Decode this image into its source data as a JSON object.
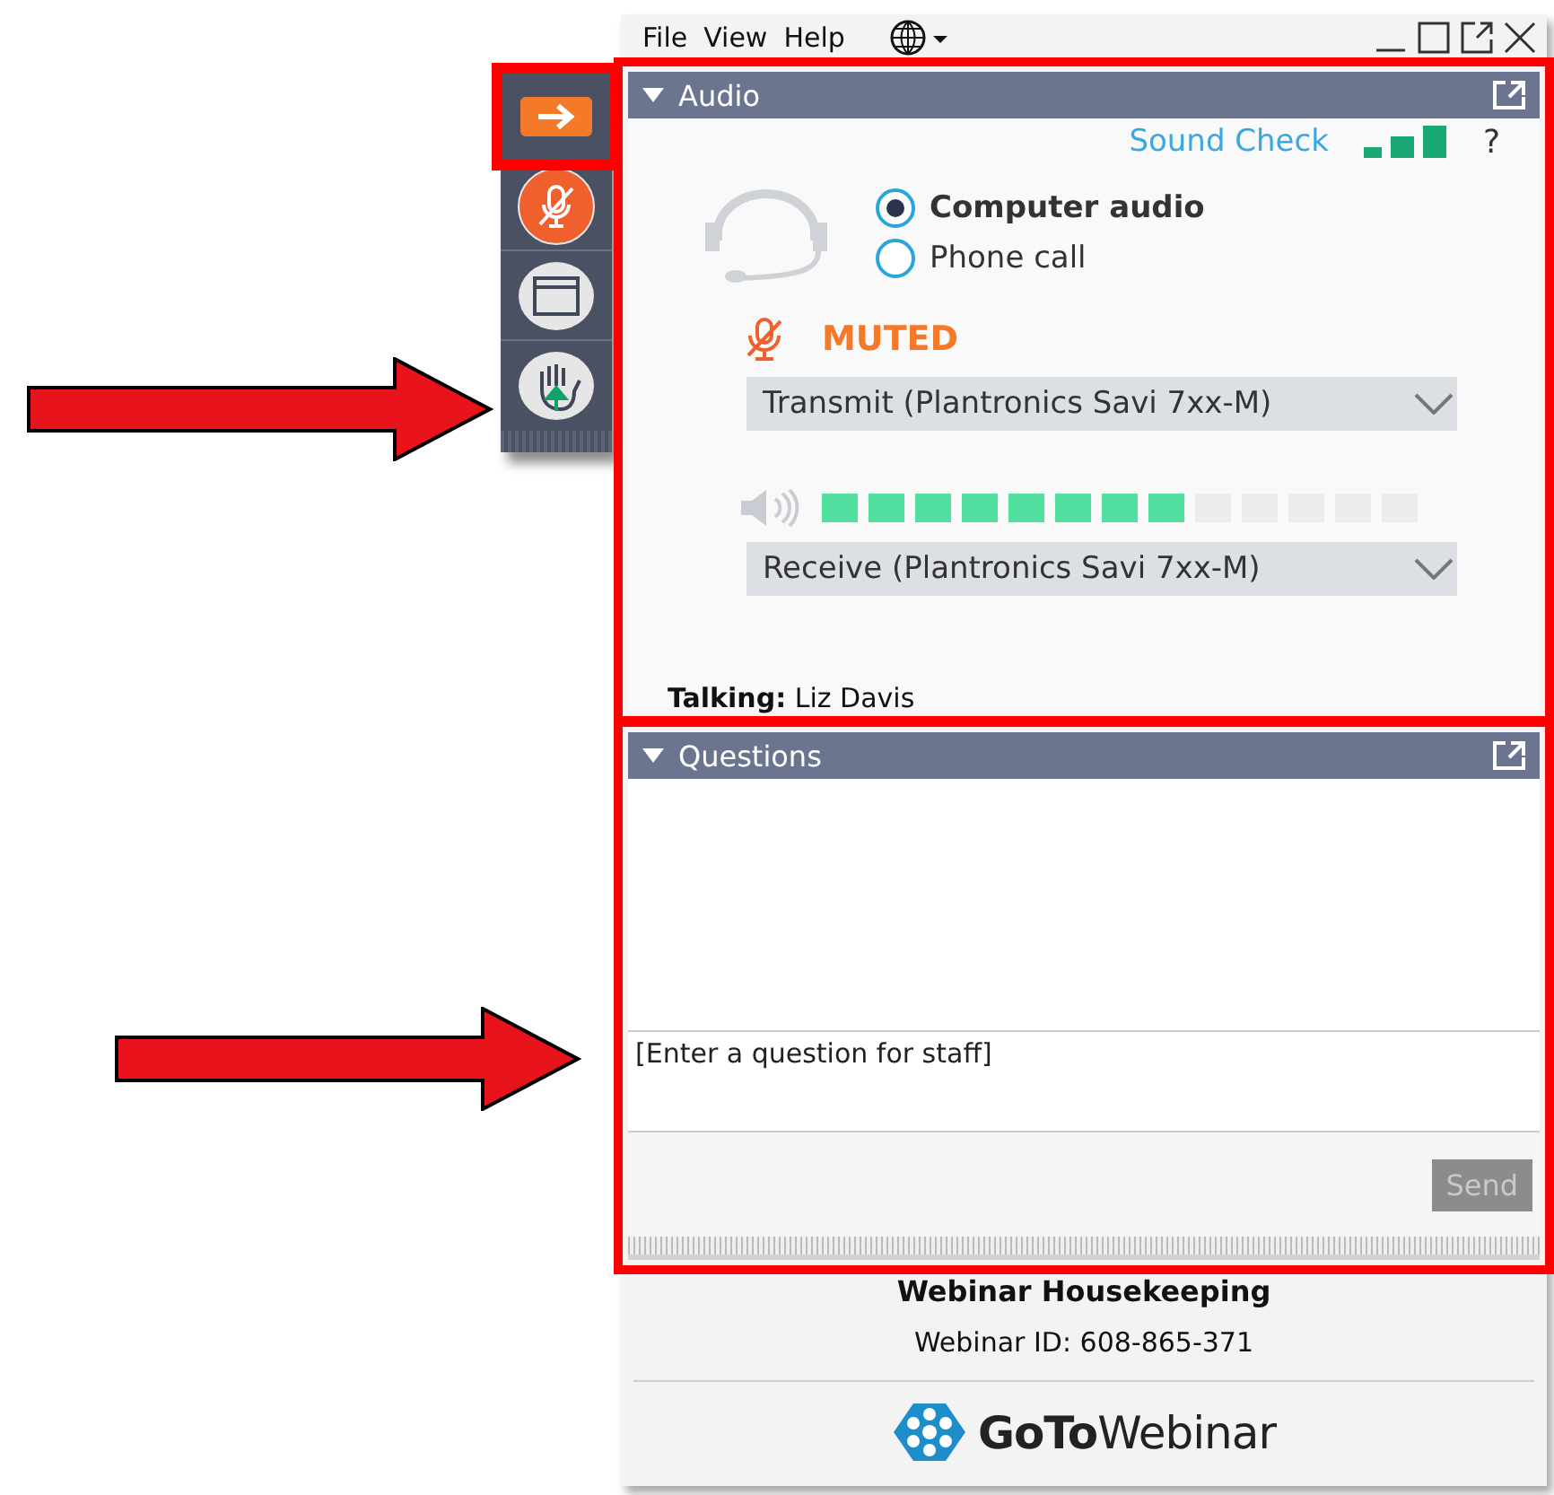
{
  "menu": [
    "File",
    "View",
    "Help"
  ],
  "toolbar": [
    {
      "kind": "collapse",
      "highlighted": true,
      "arrow": false
    },
    {
      "kind": "mic",
      "highlighted": false,
      "arrow": false
    },
    {
      "kind": "screen",
      "highlighted": false,
      "arrow": false
    },
    {
      "kind": "hand",
      "highlighted": false,
      "arrow": true
    }
  ],
  "audio": {
    "title": "Audio",
    "highlighted": true,
    "sound_check": "Sound Check",
    "help": "?",
    "modes": [
      {
        "label": "Computer audio",
        "selected": true
      },
      {
        "label": "Phone call",
        "selected": false
      }
    ],
    "mic_status": "MUTED",
    "transmit": "Transmit (Plantronics Savi 7xx-M)",
    "speaker": {
      "level": 0.615
    },
    "receive": "Receive (Plantronics Savi 7xx-M)",
    "talking": "**Talking:** Liz Davis"
  },
  "questions": {
    "title": "Questions",
    "highlighted": true,
    "placeholder": "[Enter a question for staff]",
    "arrow": true,
    "send": {
      "label": "Send",
      "disabled": true
    }
  },
  "footer": {
    "title": "Webinar Housekeeping",
    "webinar_id": "Webinar ID: 608-865-371",
    "logo": "**GoTo**Webinar"
  }
}
